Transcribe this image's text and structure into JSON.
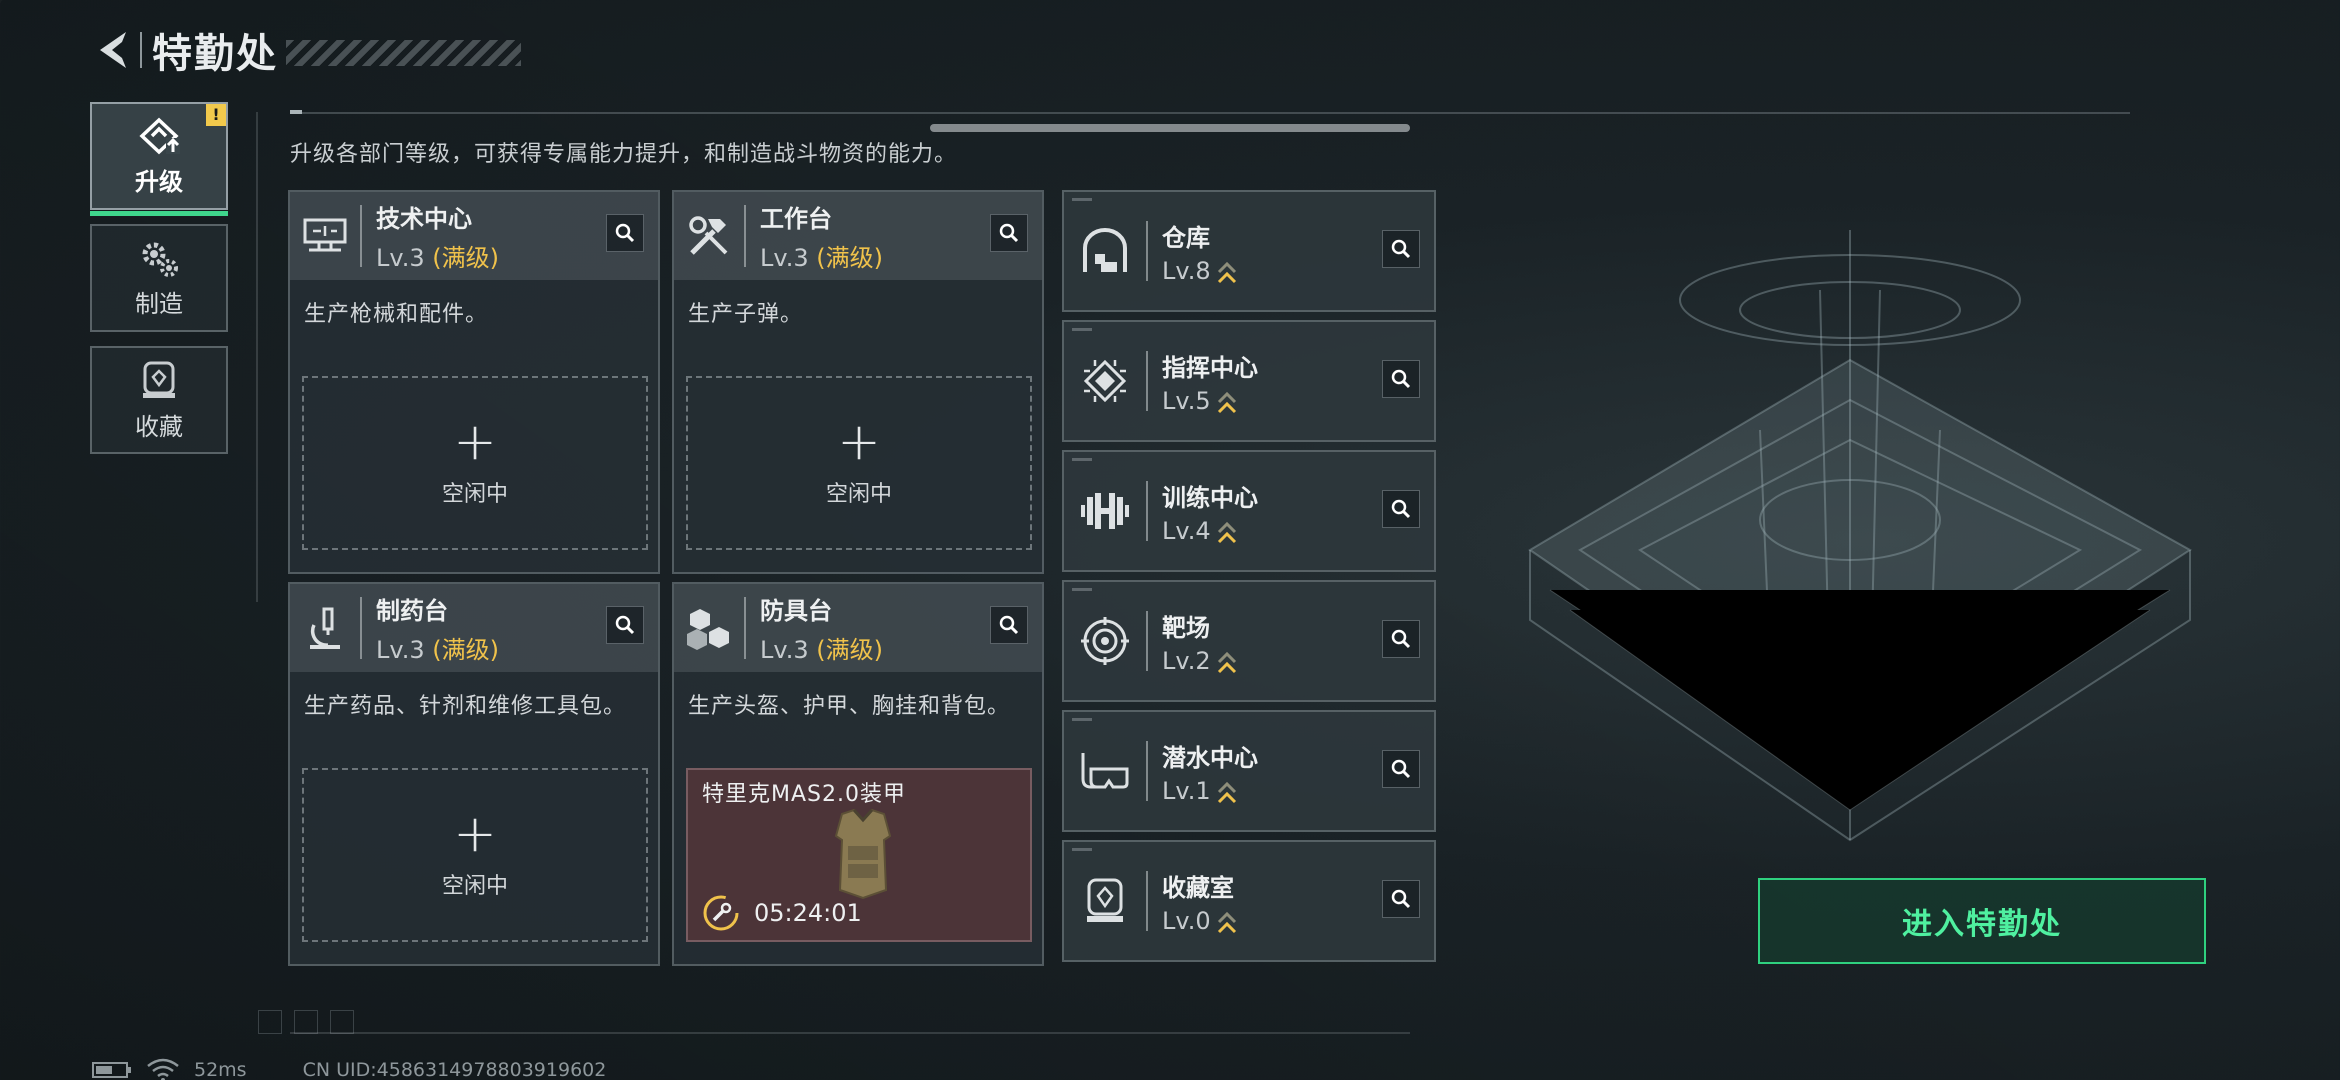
{
  "header": {
    "title": "特勤处"
  },
  "tabs": [
    {
      "label": "升级",
      "icon": "upgrade-icon",
      "badge": "!"
    },
    {
      "label": "制造",
      "icon": "craft-gears-icon"
    },
    {
      "label": "收藏",
      "icon": "collection-icon"
    }
  ],
  "description": "升级各部门等级，可获得专属能力提升，和制造战斗物资的能力。",
  "workshops": [
    {
      "name": "技术中心",
      "level": "Lv.3",
      "max_label": "(满级)",
      "desc": "生产枪械和配件。",
      "slot_label": "空闲中",
      "icon": "computer-icon"
    },
    {
      "name": "工作台",
      "level": "Lv.3",
      "max_label": "(满级)",
      "desc": "生产子弹。",
      "slot_label": "空闲中",
      "icon": "tools-icon"
    },
    {
      "name": "制药台",
      "level": "Lv.3",
      "max_label": "(满级)",
      "desc": "生产药品、针剂和维修工具包。",
      "slot_label": "空闲中",
      "icon": "microscope-icon"
    },
    {
      "name": "防具台",
      "level": "Lv.3",
      "max_label": "(满级)",
      "desc": "生产头盔、护甲、胸挂和背包。",
      "icon": "armor-cubes-icon",
      "busy": {
        "item": "特里克MAS2.0装甲",
        "time": "05:24:01"
      }
    }
  ],
  "buildings": [
    {
      "name": "仓库",
      "level": "Lv.8",
      "icon": "warehouse-icon"
    },
    {
      "name": "指挥中心",
      "level": "Lv.5",
      "icon": "command-chip-icon"
    },
    {
      "name": "训练中心",
      "level": "Lv.4",
      "icon": "dumbbell-icon"
    },
    {
      "name": "靶场",
      "level": "Lv.2",
      "icon": "target-icon"
    },
    {
      "name": "潜水中心",
      "level": "Lv.1",
      "icon": "diving-mask-icon"
    },
    {
      "name": "收藏室",
      "level": "Lv.0",
      "icon": "collection-room-icon"
    }
  ],
  "enter_button": "进入特勤处",
  "footer": {
    "ping": "52ms",
    "uid": "CN UID:4586314978803919602"
  },
  "colors": {
    "accent_green": "#2fd17f",
    "max_level_gold": "#f0c24b",
    "busy_bg": "#4c3438"
  }
}
